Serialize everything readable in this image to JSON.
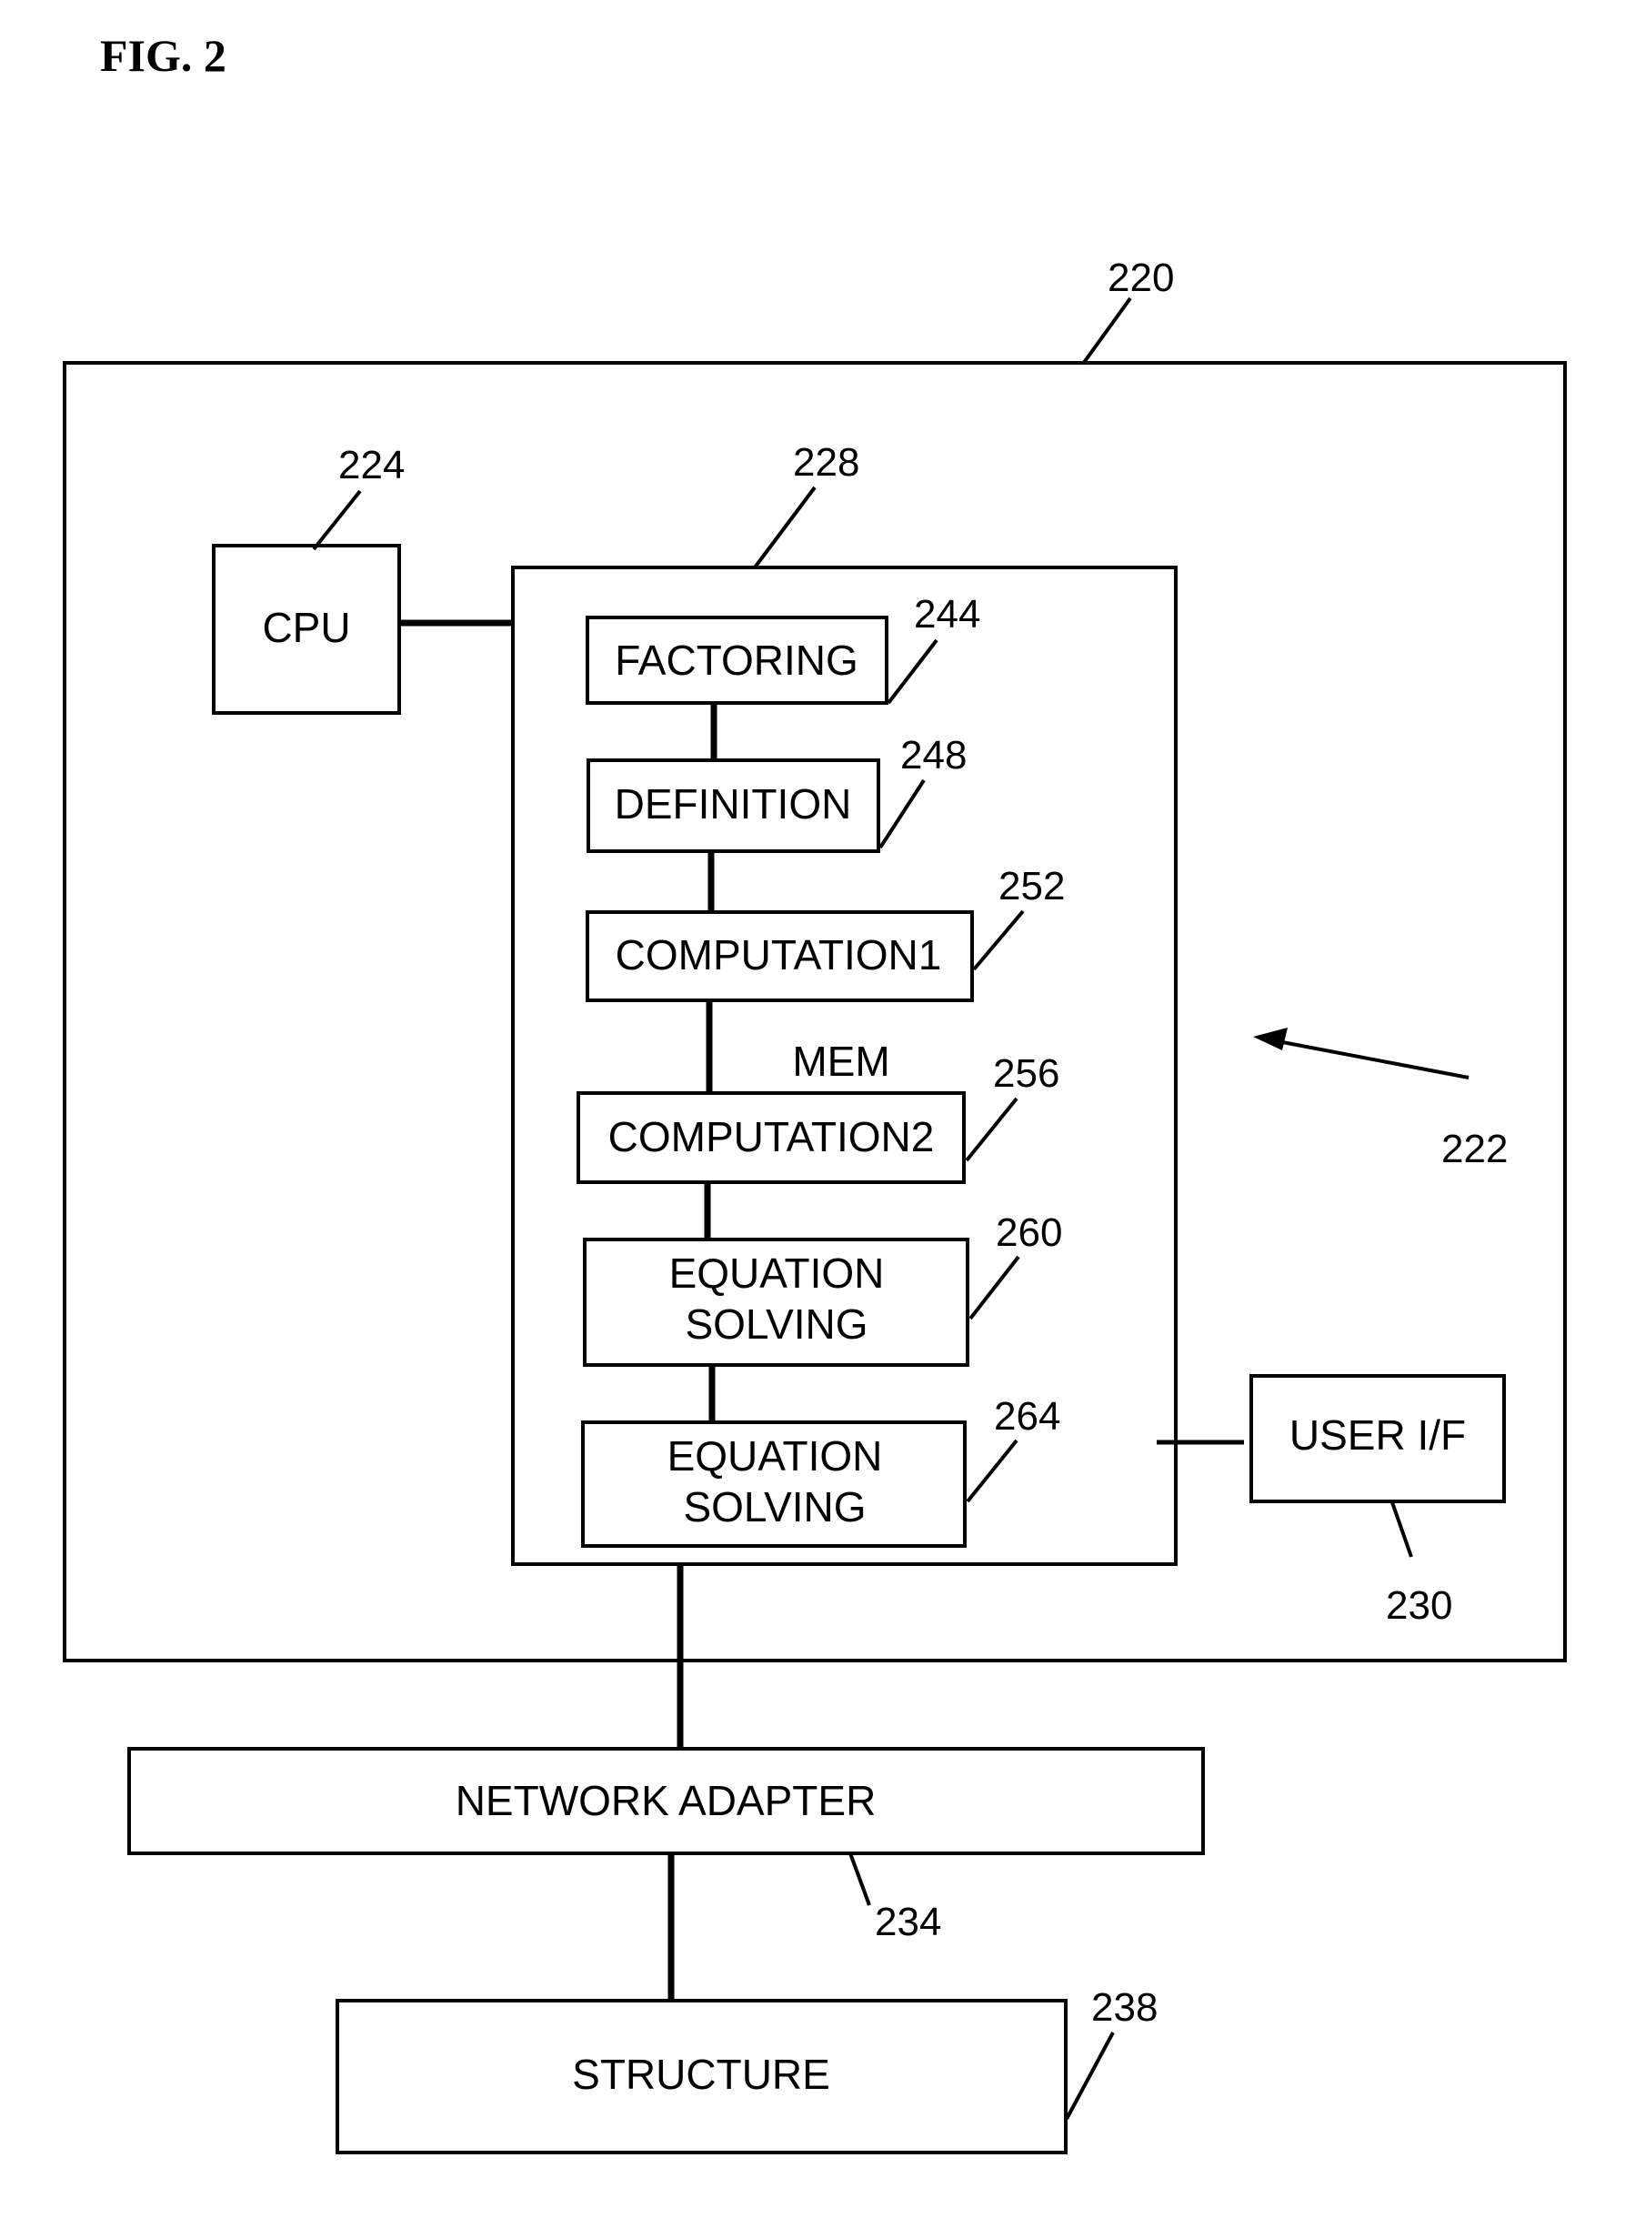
{
  "figure": {
    "title": "FIG. 2"
  },
  "system": {
    "ref": "220",
    "arrow_ref": "222"
  },
  "cpu": {
    "label": "CPU",
    "ref": "224"
  },
  "memory": {
    "label": "MEM",
    "ref": "228",
    "modules": [
      {
        "label_lines": [
          "FACTORING"
        ],
        "ref": "244"
      },
      {
        "label_lines": [
          "DEFINITION"
        ],
        "ref": "248"
      },
      {
        "label_lines": [
          "COMPUTATION1"
        ],
        "ref": "252"
      },
      {
        "label_lines": [
          "COMPUTATION2"
        ],
        "ref": "256"
      },
      {
        "label_lines": [
          "EQUATION",
          "SOLVING"
        ],
        "ref": "260"
      },
      {
        "label_lines": [
          "EQUATION",
          "SOLVING"
        ],
        "ref": "264"
      }
    ]
  },
  "user_interface": {
    "label": "USER I/F",
    "ref": "230"
  },
  "network_adapter": {
    "label": "NETWORK ADAPTER",
    "ref": "234"
  },
  "structure": {
    "label": "STRUCTURE",
    "ref": "238"
  }
}
